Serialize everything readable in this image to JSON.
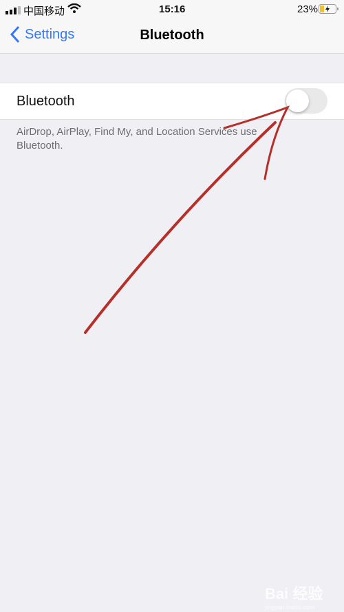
{
  "status": {
    "carrier": "中国移动",
    "time": "15:16",
    "battery": "23%"
  },
  "nav": {
    "back_label": "Settings",
    "title": "Bluetooth"
  },
  "bluetooth": {
    "label": "Bluetooth",
    "enabled": false,
    "footer": "AirDrop, AirPlay, Find My, and Location Services use Bluetooth."
  },
  "watermark": {
    "text": "Bai 经验",
    "url": "jingyan.baidu.com"
  },
  "colors": {
    "accent": "#3478f6",
    "annotation": "#b5302a"
  }
}
